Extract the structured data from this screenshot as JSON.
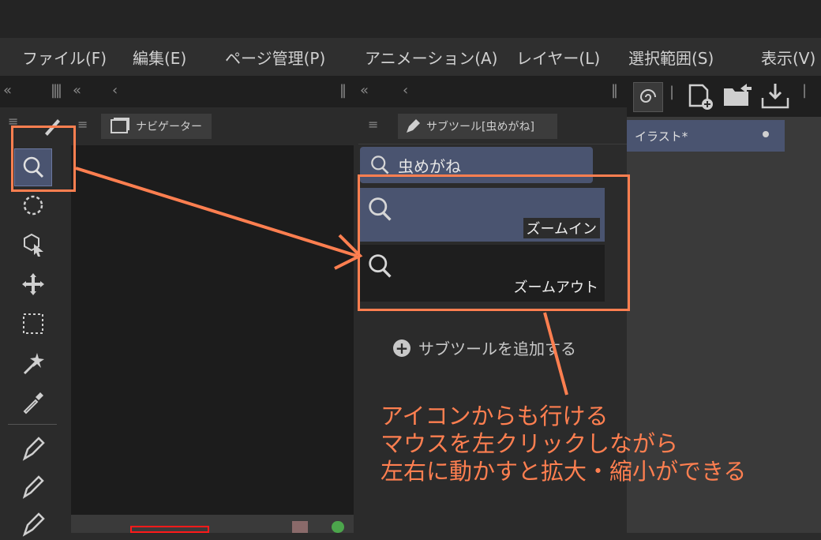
{
  "menu": {
    "items": [
      "ファイル(F)",
      "編集(E)",
      "ページ管理(P)",
      "アニメーション(A)",
      "レイヤー(L)",
      "選択範囲(S)",
      "表示(V)"
    ]
  },
  "panels": {
    "navigator_tab": "ナビゲーター",
    "subtool_tab": "サブツール[虫めがね]",
    "canvas_tab": "イラスト*"
  },
  "subtool": {
    "group_label": "虫めがね",
    "items": [
      {
        "label": "ズームイン",
        "selected": true
      },
      {
        "label": "ズームアウト",
        "selected": false
      }
    ],
    "add_label": "サブツールを追加する"
  },
  "tools": [
    "pen-icon",
    "zoom-icon",
    "rotate-icon",
    "object-select-icon",
    "move-icon",
    "rect-select-icon",
    "magic-wand-icon",
    "eyedropper-icon",
    "pen-tool-icon",
    "pencil-icon",
    "brush-icon"
  ],
  "annotation": {
    "lines": [
      "アイコンからも行ける",
      "マウスを左クリックしながら",
      "左右に動かすと拡大・縮小ができる"
    ],
    "color": "#ff7f50"
  },
  "colors": {
    "selected": "#4a5470",
    "accent": "#ff7f50"
  }
}
